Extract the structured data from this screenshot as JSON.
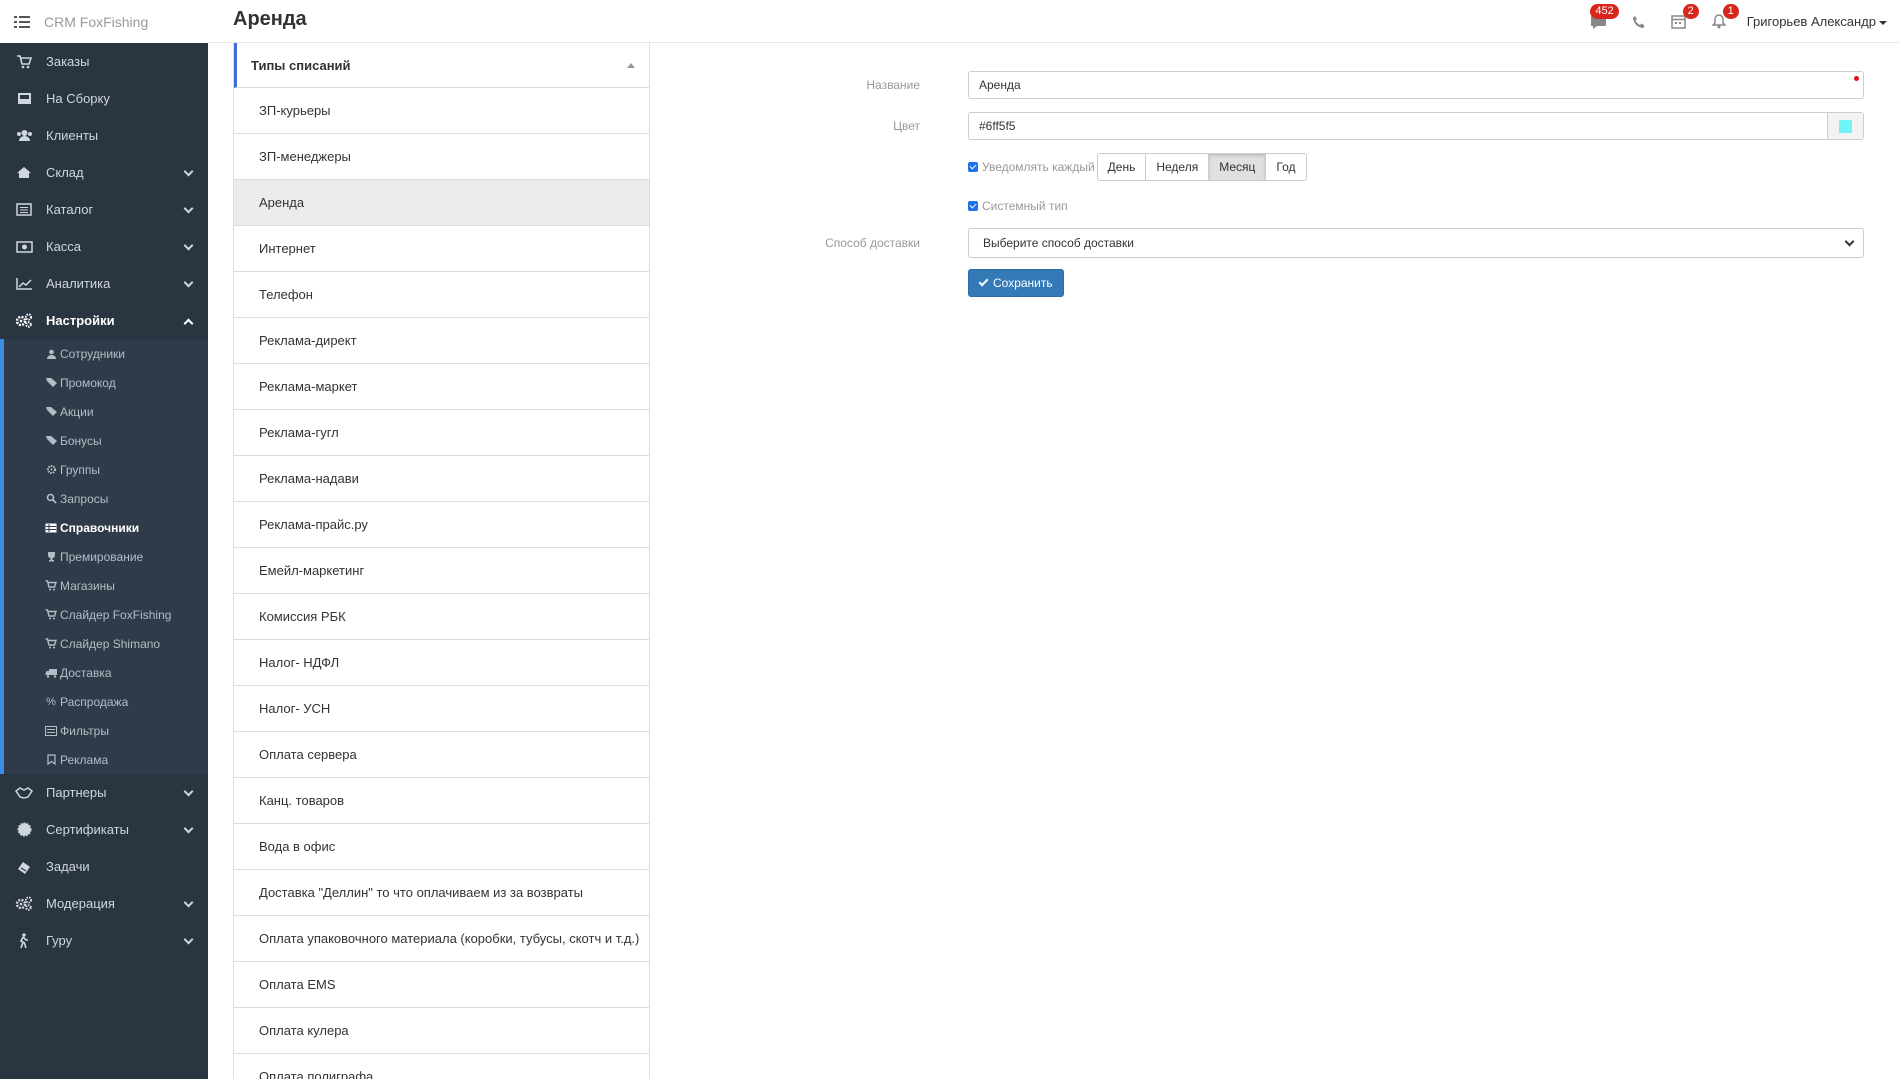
{
  "app": {
    "brand": "CRM FoxFishing",
    "page_title": "Аренда"
  },
  "header": {
    "messages_badge": "452",
    "calendar_badge": "2",
    "notifications_badge": "1",
    "user_name": "Григорьев Александр"
  },
  "sidebar": {
    "items_top": [
      {
        "label": "Заказы",
        "icon": "cart-icon"
      },
      {
        "label": "На Сборку",
        "icon": "inbox-icon"
      },
      {
        "label": "Клиенты",
        "icon": "users-icon"
      },
      {
        "label": "Склад",
        "icon": "home-icon"
      },
      {
        "label": "Каталог",
        "icon": "list-icon"
      },
      {
        "label": "Касса",
        "icon": "money-icon"
      },
      {
        "label": "Аналитика",
        "icon": "chart-icon"
      },
      {
        "label": "Настройки",
        "icon": "cogs-icon"
      }
    ],
    "sub_items": [
      {
        "label": "Сотрудники",
        "icon": "users-icon"
      },
      {
        "label": "Промокод",
        "icon": "tags-icon"
      },
      {
        "label": "Акции",
        "icon": "tags-icon"
      },
      {
        "label": "Бонусы",
        "icon": "tags-icon"
      },
      {
        "label": "Группы",
        "icon": "gear-icon"
      },
      {
        "label": "Запросы",
        "icon": "search-icon"
      },
      {
        "label": "Справочники",
        "icon": "list-icon"
      },
      {
        "label": "Премирование",
        "icon": "trophy-icon"
      },
      {
        "label": "Магазины",
        "icon": "cart-icon"
      },
      {
        "label": "Слайдер FoxFishing",
        "icon": "cart-icon"
      },
      {
        "label": "Слайдер Shimano",
        "icon": "cart-icon"
      },
      {
        "label": "Доставка",
        "icon": "truck-icon"
      },
      {
        "label": "Распродажа",
        "icon": "percent-icon"
      },
      {
        "label": "Фильтры",
        "icon": "list-icon"
      },
      {
        "label": "Реклама",
        "icon": "bookmark-icon"
      }
    ],
    "items_bottom": [
      {
        "label": "Партнеры",
        "icon": "handshake-icon"
      },
      {
        "label": "Сертификаты",
        "icon": "certificate-icon"
      },
      {
        "label": "Задачи",
        "icon": "tasks-icon"
      },
      {
        "label": "Модерация",
        "icon": "cogs-icon"
      },
      {
        "label": "Гуру",
        "icon": "walk-icon"
      }
    ]
  },
  "list": {
    "header": "Типы списаний",
    "items": [
      "ЗП-курьеры",
      "ЗП-менеджеры",
      "Аренда",
      "Интернет",
      "Телефон",
      "Реклама-директ",
      "Реклама-маркет",
      "Реклама-гугл",
      "Реклама-надави",
      "Реклама-прайс.ру",
      "Емейл-маркетинг",
      "Комиссия РБК",
      "Налог- НДФЛ",
      "Налог- УСН",
      "Оплата сервера",
      "Канц. товаров",
      "Вода в офис",
      "Доставка \"Деллин\" то что оплачиваем из за возвраты",
      "Оплата упаковочного материала (коробки, тубусы, скотч и т.д.)",
      "Оплата EMS",
      "Оплата кулера",
      "Оплата полиграфа"
    ],
    "selected_index": 2
  },
  "form": {
    "name_label": "Название",
    "name_value": "Аренда",
    "color_label": "Цвет",
    "color_value": "#6ff5f5",
    "notify_label": "Уведомлять каждый",
    "periods": [
      "День",
      "Неделя",
      "Месяц",
      "Год"
    ],
    "active_period": "Месяц",
    "system_type_label": "Системный тип",
    "delivery_label": "Способ доставки",
    "delivery_placeholder": "Выберите способ доставки",
    "save_label": "Сохранить"
  },
  "colors": {
    "sidebar_bg": "#2a3542",
    "accent": "#337ab7",
    "color_swatch": "#6ff5f5",
    "badge": "#d9261c"
  }
}
